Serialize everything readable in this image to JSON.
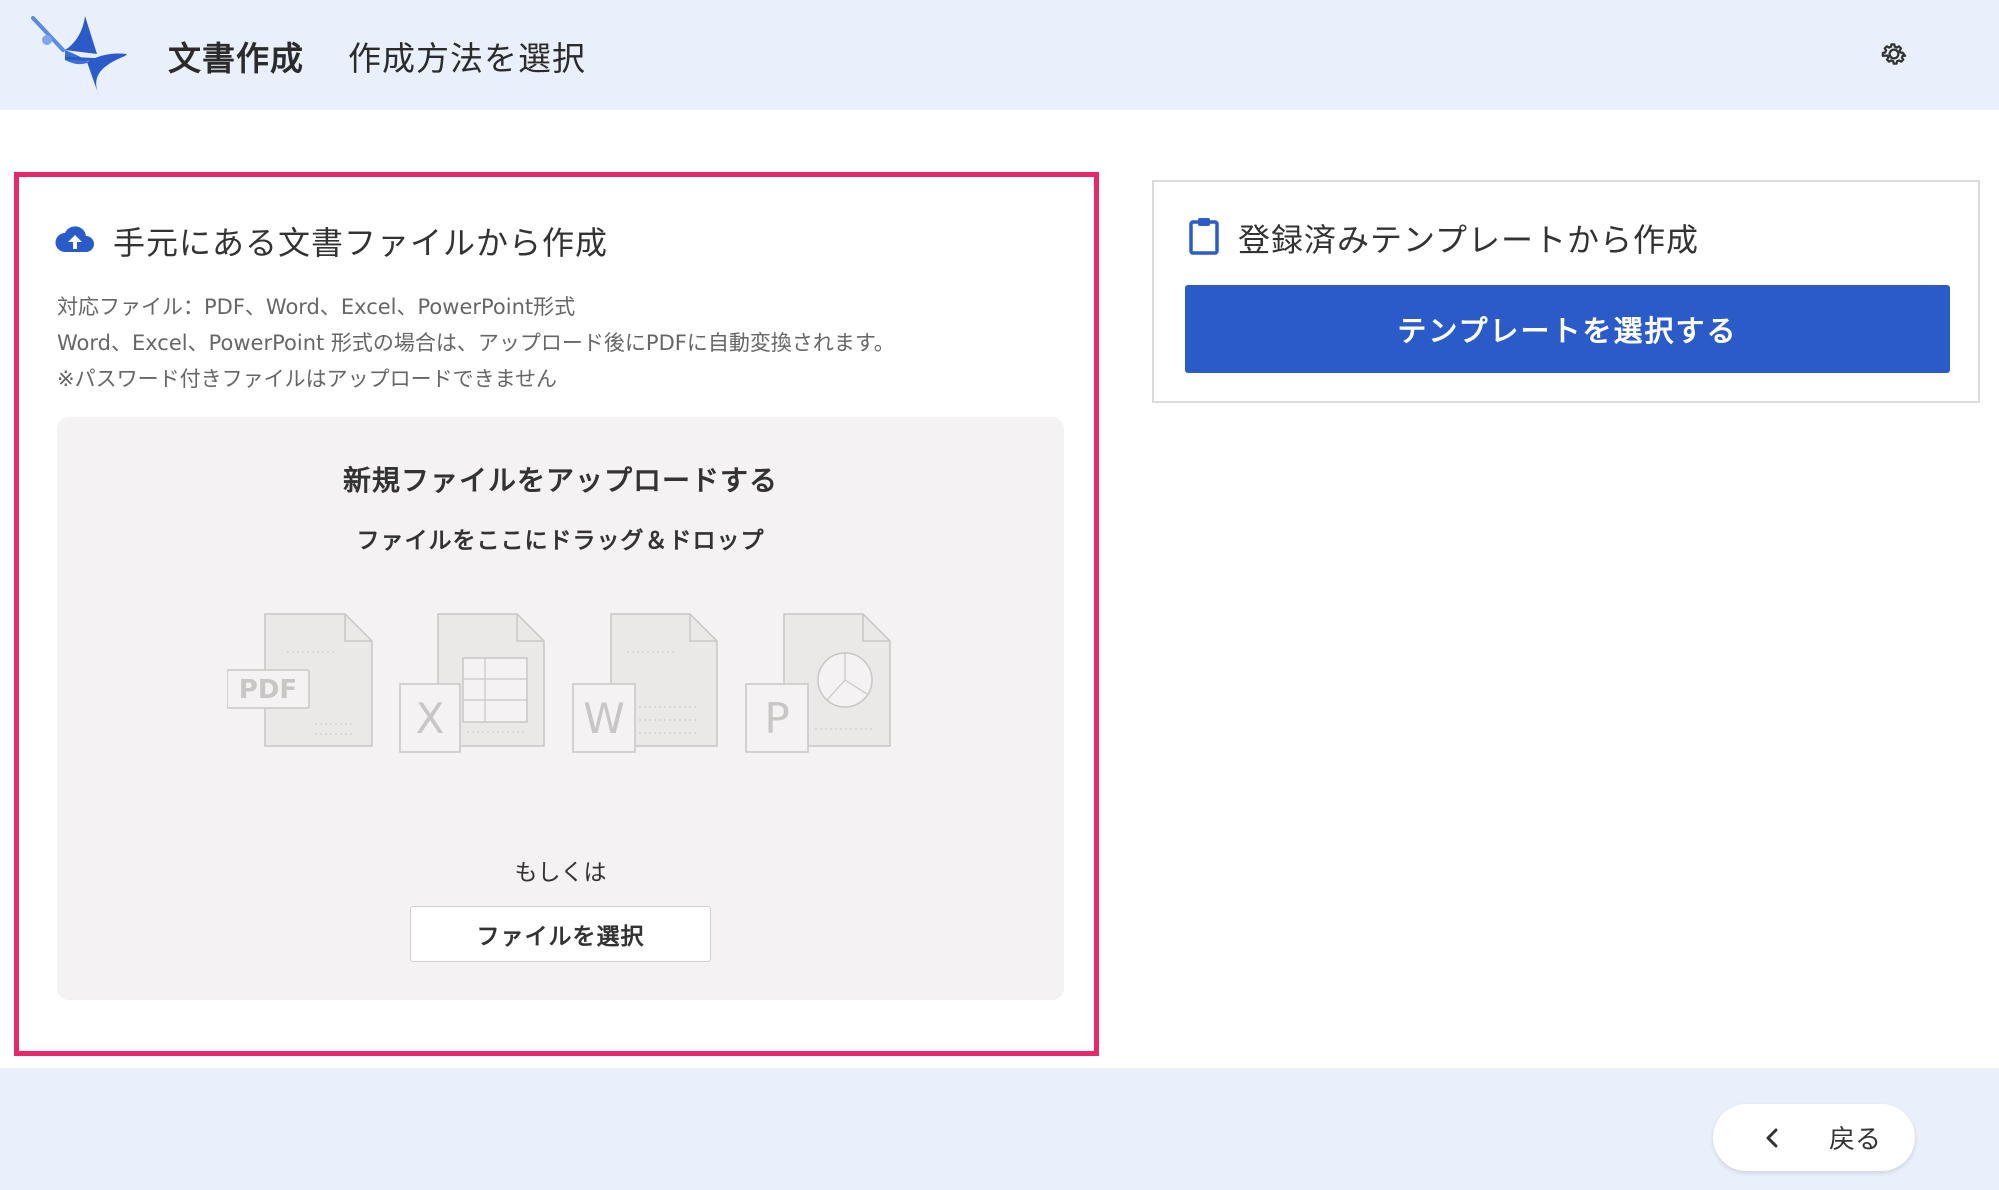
{
  "header": {
    "app_title": "文書作成",
    "page_subtitle": "作成方法を選択",
    "logo_icon": "bird-pen-logo",
    "settings_icon": "gear-icon",
    "background": "#e9f0fb"
  },
  "left_panel": {
    "title": "手元にある文書ファイルから作成",
    "title_icon": "cloud-upload-icon",
    "border_color": "#e8286a",
    "desc_lines": [
      "対応ファイル：PDF、Word、Excel、PowerPoint形式",
      "Word、Excel、PowerPoint 形式の場合は、アップロード後にPDFに自動変換されます。",
      "※パスワード付きファイルはアップロードできません"
    ],
    "dropzone": {
      "title": "新規ファイルをアップロードする",
      "subtitle": "ファイルをここにドラッグ＆ドロップ",
      "file_labels": [
        "PDF",
        "X",
        "W",
        "P"
      ],
      "or_text": "もしくは",
      "select_button": "ファイルを選択"
    }
  },
  "right_panel": {
    "title": "登録済みテンプレートから作成",
    "title_icon": "clipboard-icon",
    "button_label": "テンプレートを選択する",
    "button_color": "#2a5bc9"
  },
  "footer": {
    "back_label": "戻る",
    "back_icon": "chevron-left-icon"
  }
}
